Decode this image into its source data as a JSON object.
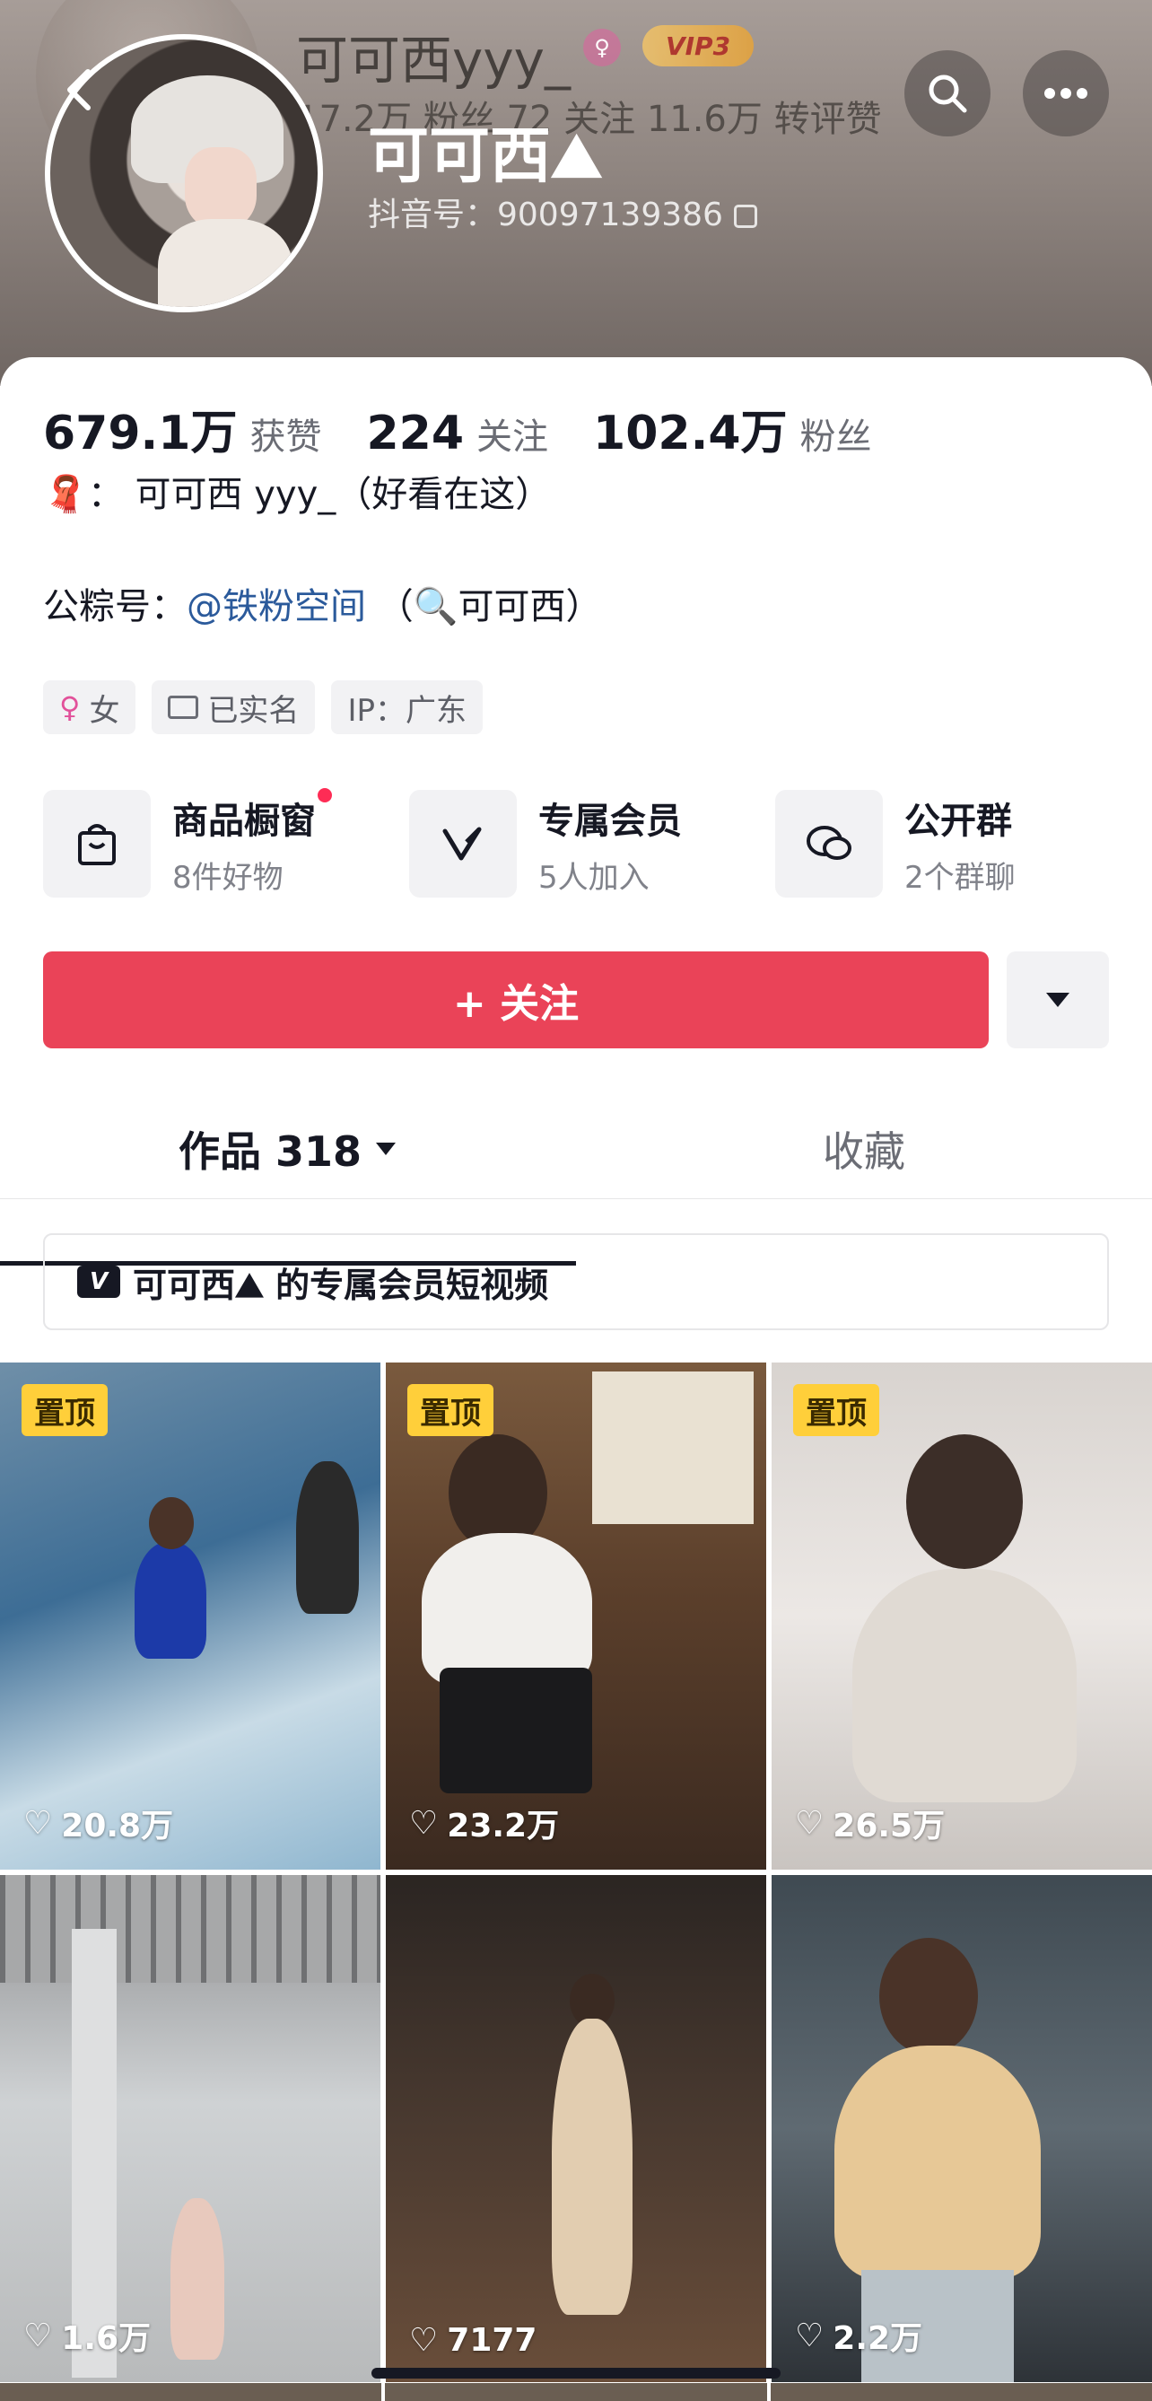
{
  "header": {
    "nickname": "可可西⛰",
    "douyin_id": "抖音号：90097139386",
    "ghost_name": "可可西yyy_",
    "ghost_stats": "17.2万 粉丝    72 关注    11.6万 转评赞",
    "vip_badge": "VIP3",
    "back_icon": "chevron-left-icon",
    "search_icon": "search-icon",
    "more_icon": "more-icon"
  },
  "stats": [
    {
      "value": "679.1万",
      "label": "获赞"
    },
    {
      "value": "224",
      "label": "关注"
    },
    {
      "value": "102.4万",
      "label": "粉丝"
    }
  ],
  "bio": {
    "line1": "：  可可西 yyy_（好看在这）",
    "gzh_prefix": "公粽号：",
    "gzh_link": "@铁粉空间",
    "gzh_suffix": "  （🔍可可西）"
  },
  "tags": {
    "gender": "女",
    "verified": "已实名",
    "ip": "IP：广东"
  },
  "services": [
    {
      "title": "商品橱窗",
      "sub": "8件好物"
    },
    {
      "title": "专属会员",
      "sub": "5人加入"
    },
    {
      "title": "公开群",
      "sub": "2个群聊"
    }
  ],
  "follow_button": "+ 关注",
  "tabs": {
    "works": "作品 318",
    "favorites": "收藏"
  },
  "member_banner": "可可西⛰ 的专属会员短视频",
  "videos": [
    {
      "pinned": "置顶",
      "likes": "20.8万"
    },
    {
      "pinned": "置顶",
      "likes": "23.2万"
    },
    {
      "pinned": "置顶",
      "likes": "26.5万"
    },
    {
      "pinned": "",
      "likes": "1.6万"
    },
    {
      "pinned": "",
      "likes": "7177"
    },
    {
      "pinned": "",
      "likes": "2.2万"
    }
  ],
  "colors": {
    "follow_red": "#ea4358",
    "pin_yellow": "#ffcf3a",
    "link_blue": "#2b5a9b"
  }
}
